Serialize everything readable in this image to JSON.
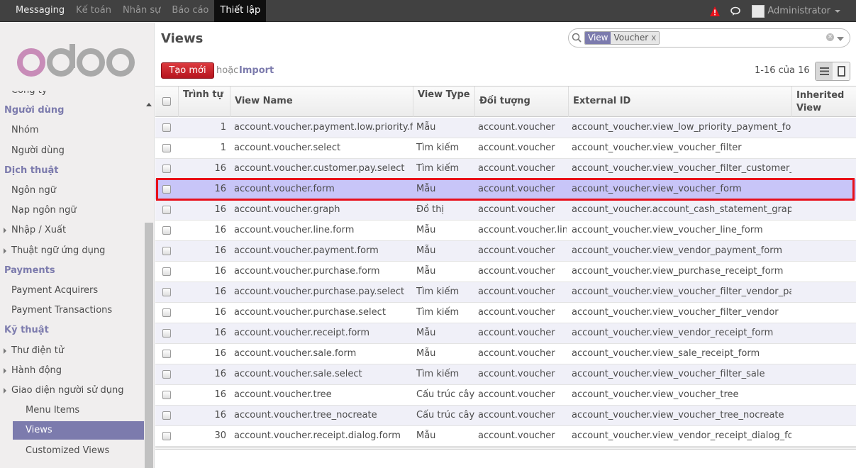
{
  "topbar": {
    "menu": [
      "Messaging",
      "Kế toán",
      "Nhân sự",
      "Báo cáo",
      "Thiết lập"
    ],
    "active_index": 4,
    "user": "Administrator",
    "icons": [
      "alert-icon",
      "chat-icon"
    ],
    "alert_color": "#e8101a"
  },
  "sidebar": {
    "logo_text": "odoo",
    "items": [
      {
        "type": "sub",
        "label": "Công ty"
      },
      {
        "type": "head",
        "label": "Người dùng"
      },
      {
        "type": "sub",
        "label": "Nhóm"
      },
      {
        "type": "sub",
        "label": "Người dùng"
      },
      {
        "type": "head",
        "label": "Dịch thuật"
      },
      {
        "type": "sub",
        "label": "Ngôn ngữ"
      },
      {
        "type": "sub",
        "label": "Nạp ngôn ngữ"
      },
      {
        "type": "tri",
        "label": "Nhập / Xuất"
      },
      {
        "type": "tri",
        "label": "Thuật ngữ ứng dụng"
      },
      {
        "type": "head",
        "label": "Payments"
      },
      {
        "type": "sub",
        "label": "Payment Acquirers"
      },
      {
        "type": "sub",
        "label": "Payment Transactions"
      },
      {
        "type": "head",
        "label": "Kỹ thuật"
      },
      {
        "type": "tri",
        "label": "Thư điện tử"
      },
      {
        "type": "tri",
        "label": "Hành động"
      },
      {
        "type": "tri",
        "label": "Giao diện người sử dụng"
      },
      {
        "type": "sub2",
        "label": "Menu Items"
      },
      {
        "type": "active",
        "label": "Views"
      },
      {
        "type": "sub2",
        "label": "Customized Views"
      }
    ]
  },
  "main": {
    "title": "Views",
    "search": {
      "facet_category": "View",
      "facet_value": "Voucher",
      "facet_remove": "x"
    },
    "create_label": "Tạo mới",
    "or_label": "hoặc",
    "import_label": "Import",
    "pager": "1-16 của 16",
    "view_modes": [
      "list-view-icon",
      "form-view-icon"
    ]
  },
  "table": {
    "columns": [
      "Trình tự",
      "View Name",
      "View Type",
      "Đối tượng",
      "External ID",
      "Inherited View"
    ],
    "rows": [
      [
        "1",
        "account.voucher.payment.low.priority.form",
        "Mẫu",
        "account.voucher",
        "account_voucher.view_low_priority_payment_form"
      ],
      [
        "1",
        "account.voucher.select",
        "Tìm kiếm",
        "account.voucher",
        "account_voucher.view_voucher_filter"
      ],
      [
        "16",
        "account.voucher.customer.pay.select",
        "Tìm kiếm",
        "account.voucher",
        "account_voucher.view_voucher_filter_customer_pay"
      ],
      [
        "16",
        "account.voucher.form",
        "Mẫu",
        "account.voucher",
        "account_voucher.view_voucher_form"
      ],
      [
        "16",
        "account.voucher.graph",
        "Đồ thị",
        "account.voucher",
        "account_voucher.account_cash_statement_graph"
      ],
      [
        "16",
        "account.voucher.line.form",
        "Mẫu",
        "account.voucher.line",
        "account_voucher.view_voucher_line_form"
      ],
      [
        "16",
        "account.voucher.payment.form",
        "Mẫu",
        "account.voucher",
        "account_voucher.view_vendor_payment_form"
      ],
      [
        "16",
        "account.voucher.purchase.form",
        "Mẫu",
        "account.voucher",
        "account_voucher.view_purchase_receipt_form"
      ],
      [
        "16",
        "account.voucher.purchase.pay.select",
        "Tìm kiếm",
        "account.voucher",
        "account_voucher.view_voucher_filter_vendor_pay"
      ],
      [
        "16",
        "account.voucher.purchase.select",
        "Tìm kiếm",
        "account.voucher",
        "account_voucher.view_voucher_filter_vendor"
      ],
      [
        "16",
        "account.voucher.receipt.form",
        "Mẫu",
        "account.voucher",
        "account_voucher.view_vendor_receipt_form"
      ],
      [
        "16",
        "account.voucher.sale.form",
        "Mẫu",
        "account.voucher",
        "account_voucher.view_sale_receipt_form"
      ],
      [
        "16",
        "account.voucher.sale.select",
        "Tìm kiếm",
        "account.voucher",
        "account_voucher.view_voucher_filter_sale"
      ],
      [
        "16",
        "account.voucher.tree",
        "Cấu trúc cây",
        "account.voucher",
        "account_voucher.view_voucher_tree"
      ],
      [
        "16",
        "account.voucher.tree_nocreate",
        "Cấu trúc cây",
        "account.voucher",
        "account_voucher.view_voucher_tree_nocreate"
      ],
      [
        "30",
        "account.voucher.receipt.dialog.form",
        "Mẫu",
        "account.voucher",
        "account_voucher.view_vendor_receipt_dialog_form"
      ]
    ],
    "selected_row": 3,
    "colors": {
      "selected": "#c8c5f8",
      "accent": "#7c7bad",
      "highlight_border": "#e8101a"
    }
  }
}
